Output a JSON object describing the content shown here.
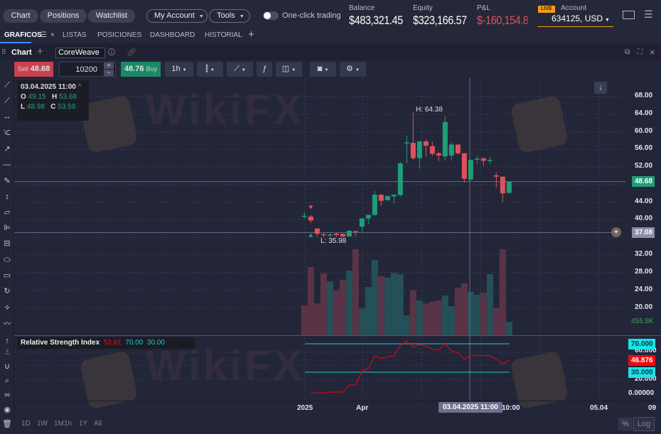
{
  "topbar": {
    "chart": "Chart",
    "positions": "Positions",
    "watchlist": "Watchlist",
    "my_account": "My Account",
    "tools": "Tools",
    "one_click": "One-click trading",
    "balance_label": "Balance",
    "balance": "$483,321.45",
    "equity_label": "Equity",
    "equity": "$323,166.57",
    "pnl_label": "P&L",
    "pnl": "$-160,154.8",
    "live": "LIVE",
    "account_label": "Account",
    "account": "634125, USD"
  },
  "tabs": [
    "GRAFICOS",
    "LISTAS",
    "POSICIONES",
    "DASHBOARD",
    "HISTORIAL"
  ],
  "chartbar": {
    "title": "Chart",
    "symbol": "CoreWeave"
  },
  "toolbar": {
    "sell_label": "Sell",
    "sell_price": "48.68",
    "quantity": "10200",
    "buy_price": "48.76",
    "buy_label": "Buy",
    "timeframe": "1h"
  },
  "ohlc": {
    "date": "03.04.2025 11:00",
    "o_label": "O",
    "o": "49.15",
    "h_label": "H",
    "h": "53.68",
    "l_label": "L",
    "l": "48.98",
    "c_label": "C",
    "c": "53.59"
  },
  "annotations": {
    "high": "H: 64.38",
    "low": "L: 35.98"
  },
  "price_axis": [
    "68.00",
    "64.00",
    "60.00",
    "56.00",
    "52.00",
    "44.00",
    "40.00",
    "32.00",
    "28.00",
    "24.00",
    "20.00"
  ],
  "price_tags": {
    "last": "48.68",
    "crosshair": "37.08",
    "volume": "455.8K"
  },
  "rsi": {
    "title": "Relative Strength Index",
    "value": "53.81",
    "upper": "70.00",
    "lower": "30.00",
    "axis": [
      "60.000",
      "20.000",
      "0.00000"
    ],
    "tag_upper": "70.000",
    "tag_value": "46.876",
    "tag_lower": "30.000"
  },
  "time_axis": {
    "t1": "2025",
    "t2": "Apr",
    "crosshair": "03.04.2025 11:00",
    "t3": "10:00",
    "t4": "05.04",
    "t5": "09"
  },
  "ranges": [
    "1D",
    "1W",
    "1M1h",
    "1Y",
    "All"
  ],
  "bottom": {
    "pct": "%",
    "log": "Log"
  },
  "watermark": "WikiFX",
  "colors": {
    "up": "#1f9e76",
    "down": "#e0525a",
    "rsi_line": "#d4070f",
    "rsi_band": "#19c9d3",
    "accent": "#f39c12"
  },
  "chart_data": {
    "type": "candlestick",
    "ohlc": [
      [
        40.9,
        41.7,
        40.2,
        40.9
      ],
      [
        40.7,
        41.1,
        39.3,
        39.8
      ],
      [
        38.0,
        38.0,
        36.2,
        36.8
      ],
      [
        36.7,
        37.0,
        36.0,
        36.5
      ],
      [
        36.6,
        37.0,
        36.1,
        36.6
      ],
      [
        36.8,
        37.0,
        36.1,
        36.5
      ],
      [
        36.8,
        36.8,
        35.98,
        36.2
      ],
      [
        36.2,
        37.6,
        36.2,
        37.5
      ],
      [
        37.4,
        37.5,
        36.2,
        37.2
      ],
      [
        38.4,
        40.3,
        37.3,
        40.3
      ],
      [
        40.3,
        41.1,
        38.9,
        41.1
      ],
      [
        41.1,
        46.5,
        40.8,
        45.7
      ],
      [
        45.7,
        45.7,
        43.2,
        44.3
      ],
      [
        44.4,
        45.4,
        44.4,
        45.4
      ],
      [
        45.3,
        45.7,
        43.7,
        45.7
      ],
      [
        45.6,
        53.2,
        45.3,
        52.8
      ],
      [
        57.4,
        59.1,
        52.9,
        57.6
      ],
      [
        57.5,
        64.38,
        53.6,
        54.0
      ],
      [
        54.0,
        58.0,
        51.6,
        57.8
      ],
      [
        57.8,
        58.3,
        54.4,
        56.8
      ],
      [
        56.7,
        57.7,
        54.6,
        55.0
      ],
      [
        55.1,
        55.4,
        53.3,
        54.6
      ],
      [
        54.4,
        63.6,
        53.5,
        62.2
      ],
      [
        54.6,
        57.6,
        53.5,
        57.1
      ],
      [
        57.1,
        57.1,
        54.8,
        55.1
      ],
      [
        55.1,
        55.2,
        48.4,
        49.3
      ],
      [
        49.15,
        53.68,
        48.98,
        53.59
      ],
      [
        53.8,
        54.6,
        52.8,
        53.9
      ],
      [
        54.0,
        54.0,
        52.3,
        53.4
      ],
      [
        53.4,
        54.4,
        52.8,
        53.6
      ],
      [
        50.1,
        50.8,
        47.3,
        49.8
      ],
      [
        49.8,
        49.8,
        44.0,
        46.0
      ],
      [
        46.1,
        48.7,
        46.0,
        48.68
      ]
    ],
    "volume_k": [
      1008,
      2304,
      1072,
      2088,
      1824,
      1512,
      1872,
      2184,
      2904,
      904,
      1632,
      2544,
      1992,
      1944,
      2112,
      2064,
      672,
      1512,
      1176,
      1072,
      1128,
      1176,
      1344,
      984,
      1608,
      1752,
      1464,
      1368,
      1440,
      2064,
      928,
      2904,
      455.8
    ],
    "volume_up": [
      0,
      0,
      0,
      0,
      1,
      0,
      0,
      1,
      0,
      1,
      1,
      1,
      0,
      1,
      1,
      1,
      1,
      0,
      1,
      0,
      0,
      0,
      1,
      1,
      0,
      0,
      1,
      1,
      0,
      1,
      0,
      0,
      1
    ],
    "rsi": [
      null,
      0.7,
      0.7,
      0.7,
      2,
      2,
      2,
      12,
      12,
      32,
      35,
      53,
      49,
      51.7,
      53,
      68,
      74,
      65,
      69,
      67,
      62.5,
      61,
      70,
      60,
      57,
      48,
      54,
      53.5,
      53.5,
      53.5,
      48,
      42,
      46.9
    ],
    "ylim": [
      20,
      68
    ],
    "rsi_ylim": [
      0,
      100
    ],
    "last": 48.68,
    "crosshair_price": 37.08
  }
}
